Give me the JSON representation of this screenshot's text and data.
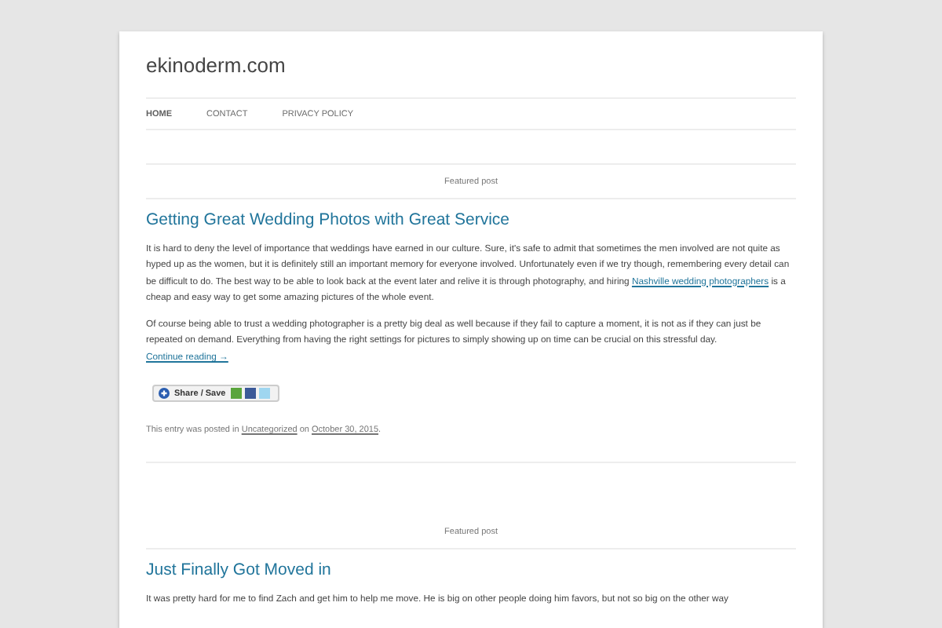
{
  "site": {
    "title": "ekinoderm.com"
  },
  "nav": [
    {
      "label": "HOME",
      "selected": true
    },
    {
      "label": "CONTACT",
      "selected": false
    },
    {
      "label": "PRIVACY POLICY",
      "selected": false
    }
  ],
  "posts": [
    {
      "featured_label": "Featured post",
      "title": "Getting Great Wedding Photos with Great Service",
      "paragraphs": [
        {
          "before": "It is hard to deny the level of importance that weddings have earned in our culture. Sure, it's safe to admit that sometimes the men involved are not quite as hyped up as the women, but it is definitely still an important memory for everyone involved. Unfortunately even if we try though, remembering every detail can be difficult to do. The best way to be able to look back at the event later and relive it is through photography, and hiring ",
          "link": "Nashville wedding photographers",
          "after": " is a cheap and easy way to get some amazing pictures of the whole event."
        },
        {
          "before": "Of course being able to trust a wedding photographer is a pretty big deal as well because if they fail to capture a moment, it is not as if they can just be repeated on demand. Everything from having the right settings for pictures to simply showing up on time can be crucial on this stressful day."
        }
      ],
      "continue_link": "Continue reading →",
      "share_button": "Share / Save",
      "meta": {
        "before": "This entry was posted in ",
        "category": "Uncategorized",
        "middle": " on ",
        "date": "October 30, 2015",
        "after": "."
      }
    },
    {
      "featured_label": "Featured post",
      "title": "Just Finally Got Moved in",
      "paragraphs": [
        {
          "before": "It was pretty hard for me to find Zach and get him to help me move. He is big on other people doing him favors, but not so big on the other way"
        }
      ]
    }
  ]
}
